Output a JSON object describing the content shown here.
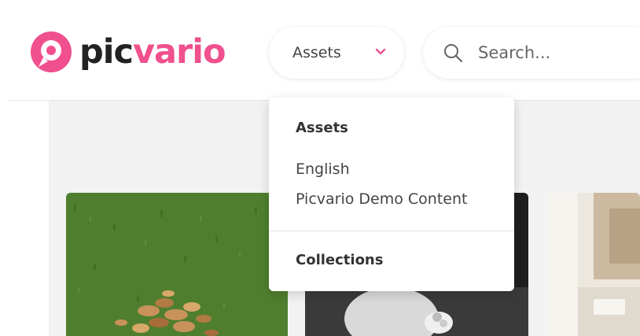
{
  "brand": {
    "name_dark": "pic",
    "name_accent": "vario",
    "accent_color": "#f0508e"
  },
  "header": {
    "asset_selector": {
      "label": "Assets",
      "icon": "chevron-down-icon"
    },
    "search": {
      "placeholder": "Search...",
      "value": "",
      "icon": "search-icon"
    }
  },
  "dropdown": {
    "sections": [
      {
        "heading": "Assets",
        "items": [
          "English",
          "Picvario Demo Content"
        ]
      },
      {
        "heading": "Collections",
        "items": []
      }
    ]
  },
  "gallery": {
    "cards": [
      {
        "subject": "autumn leaves on grass"
      },
      {
        "subject": "black and white photo"
      },
      {
        "subject": "beige interior"
      }
    ]
  }
}
